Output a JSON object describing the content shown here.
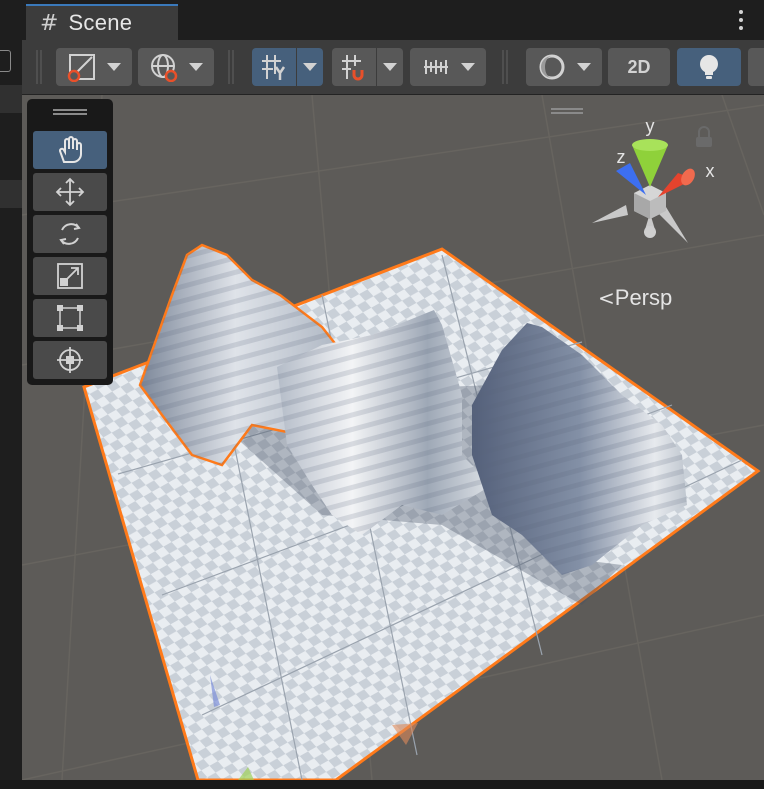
{
  "window": {
    "tab_title": "Scene",
    "tab_icon": "hash-icon",
    "menu_icon": "kebab-menu-icon"
  },
  "toolbar": {
    "draw_mode_icon": "shaded-draw-mode-icon",
    "global_icon": "global-space-icon",
    "grid_icon": "grid-snap-icon",
    "snap_icon": "increment-snap-icon",
    "ruler_icon": "grid-ruler-icon",
    "render_icon": "render-mode-icon",
    "mode_2d_label": "2D",
    "lighting_icon": "lightbulb-icon"
  },
  "tools": {
    "items": [
      "hand-tool",
      "move-tool",
      "rotate-tool",
      "scale-tool",
      "rect-tool",
      "transform-tool"
    ],
    "active": "hand-tool"
  },
  "gizmo": {
    "x_label": "x",
    "y_label": "y",
    "z_label": "z",
    "projection_label": "Persp"
  },
  "colors": {
    "selection_outline": "#ff7a1a",
    "x_axis": "#e5432d",
    "y_axis": "#8fd13a",
    "z_axis": "#3d6ff0",
    "active_button": "#46607c"
  }
}
